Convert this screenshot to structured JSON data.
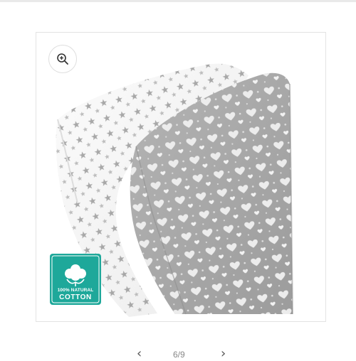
{
  "gallery": {
    "zoom_icon": "zoom-in-icon",
    "image_subject": "two crib sheets: white with grey stars, grey with white hearts",
    "badge": {
      "line1": "100% NATURAL",
      "line2": "COTTON",
      "color": "#1ea89a",
      "icon": "cotton-flower-icon"
    }
  },
  "pager": {
    "prev_icon": "chevron-left-icon",
    "next_icon": "chevron-right-icon",
    "count": "6/9"
  },
  "colors": {
    "sheet_white": "#f5f5f5",
    "sheet_grey": "#a7a7a7",
    "pattern_grey": "#9a9a9a"
  }
}
